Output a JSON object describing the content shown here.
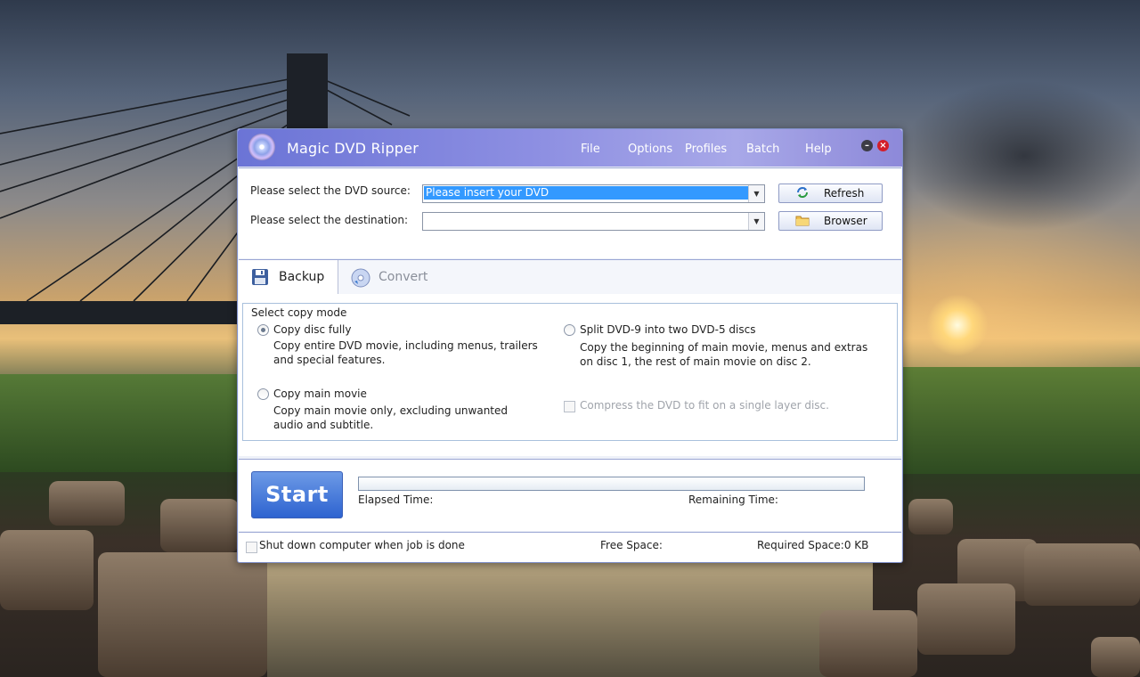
{
  "window": {
    "title": "Magic DVD Ripper",
    "menu": [
      "File",
      "Options",
      "Profiles",
      "Batch",
      "Help"
    ],
    "minimize_symbol": "–",
    "close_symbol": "×"
  },
  "source": {
    "dvd_label": "Please select the DVD source:",
    "dvd_value": "Please insert your DVD",
    "destination_label": "Please select the destination:",
    "destination_value": "",
    "refresh_label": "Refresh",
    "refresh_icon": "refresh-icon",
    "browser_label": "Browser",
    "browser_icon": "folder-icon"
  },
  "tabs": [
    {
      "label": "Backup",
      "icon": "floppy-disk-icon",
      "active": true
    },
    {
      "label": "Convert",
      "icon": "disc-convert-icon",
      "active": false
    }
  ],
  "copy_mode": {
    "title": "Select copy mode",
    "options": [
      {
        "title": "Copy disc fully",
        "desc1": "Copy entire DVD movie, including menus, trailers",
        "desc2": "and special features.",
        "selected": true
      },
      {
        "title": "Copy main movie",
        "desc1": "Copy main movie only, excluding unwanted",
        "desc2": "audio and subtitle.",
        "selected": false
      },
      {
        "title": "Split DVD-9 into two DVD-5 discs",
        "desc1": "Copy the beginning of main movie, menus and extras",
        "desc2": "on disc 1, the rest of main movie on disc 2.",
        "selected": false
      }
    ],
    "compress_label": "Compress the DVD to fit on a single layer disc.",
    "compress_checked": false
  },
  "progress": {
    "start_label": "Start",
    "elapsed_label": "Elapsed Time:",
    "remaining_label": "Remaining Time:",
    "fraction": 0
  },
  "status": {
    "shutdown_label": "Shut down computer when job is done",
    "shutdown_checked": false,
    "free_space_label": "Free Space:",
    "required_space_label": "Required Space:0 KB"
  },
  "colors": {
    "titlebar": "#7f83dc",
    "start_button": "#3b6fd6",
    "selection": "#3399ff"
  }
}
